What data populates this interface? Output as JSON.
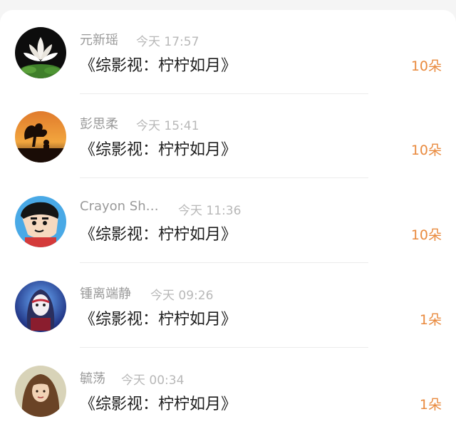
{
  "gifts": [
    {
      "name": "元新瑶",
      "time": "今天 17:57",
      "title": "《综影视：柠柠如月》",
      "count": "10朵",
      "avatar": "lotus-avatar"
    },
    {
      "name": "彭思柔",
      "time": "今天 15:41",
      "title": "《综影视：柠柠如月》",
      "count": "10朵",
      "avatar": "sunset-silhouette-avatar"
    },
    {
      "name": "Crayon Sh…",
      "time": "今天 11:36",
      "title": "《综影视：柠柠如月》",
      "count": "10朵",
      "avatar": "crayon-shin-chan-avatar"
    },
    {
      "name": "锺离端静",
      "time": "今天 09:26",
      "title": "《综影视：柠柠如月》",
      "count": "1朵",
      "avatar": "masked-anime-girl-avatar"
    },
    {
      "name": "毓荡",
      "time": "今天 00:34",
      "title": "《综影视：柠柠如月》",
      "count": "1朵",
      "avatar": "long-hair-girl-avatar"
    }
  ],
  "colors": {
    "accent": "#e98a3e",
    "name": "#9a9a9a",
    "time": "#b8b8b8",
    "title": "#1f1f1f"
  }
}
